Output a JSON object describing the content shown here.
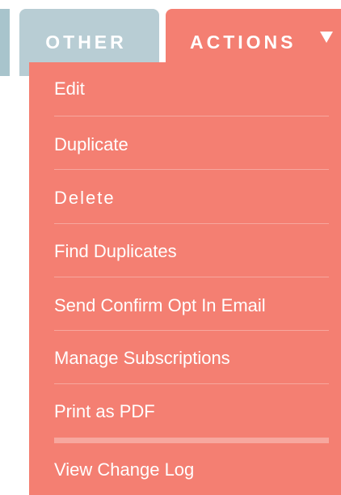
{
  "tabs": {
    "other_label": "OTHER",
    "actions_label": "ACTIONS"
  },
  "menu": {
    "items": [
      {
        "label": "Edit"
      },
      {
        "label": "Duplicate"
      },
      {
        "label": "Delete"
      },
      {
        "label": "Find Duplicates"
      },
      {
        "label": "Send Confirm Opt In Email"
      },
      {
        "label": "Manage Subscriptions"
      },
      {
        "label": "Print as PDF"
      },
      {
        "label": "View Change Log"
      }
    ]
  },
  "colors": {
    "actions_bg": "#f47f72",
    "other_bg": "#b8cdd4",
    "divider": "#f7a79e",
    "text": "#ffffff"
  },
  "icons": {
    "actions_caret": "caret-down-icon"
  }
}
